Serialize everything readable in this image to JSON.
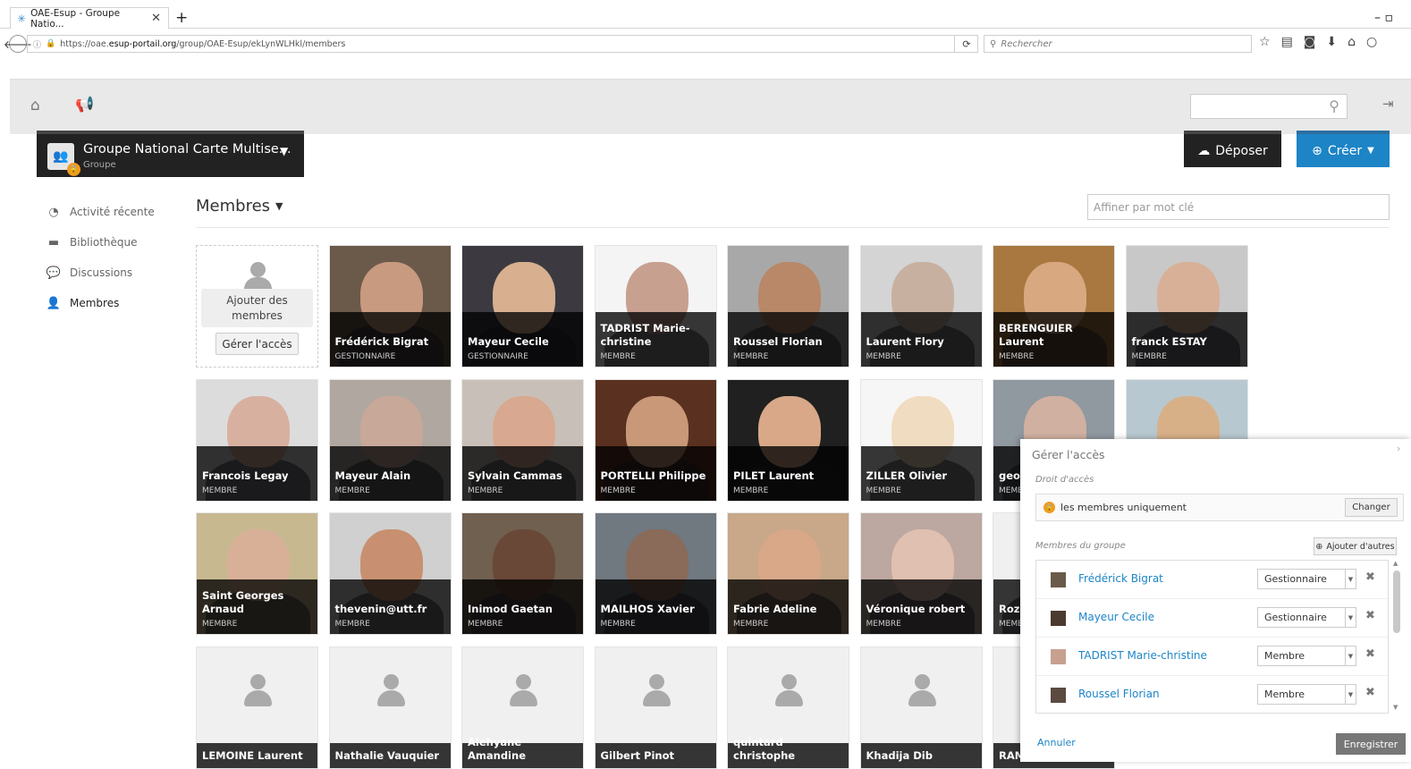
{
  "browser": {
    "tab_title": "OAE-Esup - Groupe Natio...",
    "url_prefix": "https://oae.",
    "url_host": "esup-portail.org",
    "url_path": "/group/OAE-Esup/ekLynWLHkl/members",
    "search_placeholder": "Rechercher"
  },
  "group": {
    "name": "Groupe National Carte Multise...",
    "type": "Groupe"
  },
  "actions": {
    "deposer": "Déposer",
    "creer": "Créer"
  },
  "sidebar": {
    "items": [
      {
        "label": "Activité récente",
        "icon": "dashboard-icon"
      },
      {
        "label": "Bibliothèque",
        "icon": "briefcase-icon"
      },
      {
        "label": "Discussions",
        "icon": "comments-icon"
      },
      {
        "label": "Membres",
        "icon": "user-icon"
      }
    ]
  },
  "members_view": {
    "title": "Membres",
    "filter_placeholder": "Affiner par mot clé",
    "add_members": "Ajouter des membres",
    "manage_access": "Gérer l'accès"
  },
  "members": [
    {
      "name": "Frédérick Bigrat",
      "role": "GESTIONNAIRE",
      "bg": "#6b5a4a",
      "face": "#c89a80"
    },
    {
      "name": "Mayeur Cecile",
      "role": "GESTIONNAIRE",
      "bg": "#3c3a40",
      "face": "#d8b090"
    },
    {
      "name": "TADRIST Marie-christine",
      "role": "MEMBRE",
      "bg": "#f4f4f4",
      "face": "#c8a090"
    },
    {
      "name": "Roussel Florian",
      "role": "MEMBRE",
      "bg": "#a8a8a8",
      "face": "#b88868"
    },
    {
      "name": "Laurent Flory",
      "role": "MEMBRE",
      "bg": "#d4d4d4",
      "face": "#c8b0a0"
    },
    {
      "name": "BERENGUIER Laurent",
      "role": "MEMBRE",
      "bg": "#a87840",
      "face": "#d8a880"
    },
    {
      "name": "franck ESTAY",
      "role": "MEMBRE",
      "bg": "#c8c8c8",
      "face": "#d8b098"
    },
    {
      "name": "Francois Legay",
      "role": "MEMBRE",
      "bg": "#dcdcdc",
      "face": "#d8b0a0"
    },
    {
      "name": "Mayeur Alain",
      "role": "MEMBRE",
      "bg": "#b0a8a0",
      "face": "#c8a898"
    },
    {
      "name": "Sylvain Cammas",
      "role": "MEMBRE",
      "bg": "#c8c0b8",
      "face": "#d8a890"
    },
    {
      "name": "PORTELLI Philippe",
      "role": "MEMBRE",
      "bg": "#5a3020",
      "face": "#c89878"
    },
    {
      "name": "PILET Laurent",
      "role": "MEMBRE",
      "bg": "#202020",
      "face": "#d8a888"
    },
    {
      "name": "ZILLER Olivier",
      "role": "MEMBRE",
      "bg": "#f6f6f6",
      "face": "#f0dcc0"
    },
    {
      "name": "geoffroy@...s.fr",
      "role": "MEMBRE",
      "bg": "#9098a0",
      "face": "#d0b0a0"
    },
    {
      "name": "",
      "role": "",
      "bg": "#b8c8d0",
      "face": "#d8b088"
    },
    {
      "name": "Saint Georges Arnaud",
      "role": "MEMBRE",
      "bg": "#c8b890",
      "face": "#d8b098"
    },
    {
      "name": "thevenin@utt.fr",
      "role": "MEMBRE",
      "bg": "#d0d0d0",
      "face": "#c89070"
    },
    {
      "name": "Inimod Gaetan",
      "role": "MEMBRE",
      "bg": "#706050",
      "face": "#6a4838"
    },
    {
      "name": "MAILHOS Xavier",
      "role": "MEMBRE",
      "bg": "#707880",
      "face": "#8a6a58"
    },
    {
      "name": "Fabrie Adeline",
      "role": "MEMBRE",
      "bg": "#c8a888",
      "face": "#d8a888"
    },
    {
      "name": "Véronique robert",
      "role": "MEMBRE",
      "bg": "#bca8a0",
      "face": "#e0c0b0"
    },
    {
      "name": "Roze...",
      "role": "MEMBRE",
      "bg": "#f0f0f0",
      "face": "#cccccc"
    }
  ],
  "blank_members": [
    "LEMOINE Laurent",
    "Nathalie Vauquier",
    "Alehyane Amandine",
    "Gilbert Pinot",
    "quintard christophe",
    "Khadija Dib",
    "RAM... xavie..."
  ],
  "access_panel": {
    "title": "Gérer l'accès",
    "right_label": "Droit d'accès",
    "right_value": "les membres uniquement",
    "change_button": "Changer",
    "members_label": "Membres du groupe",
    "add_others": "Ajouter d'autres",
    "rows": [
      {
        "name": "Frédérick Bigrat",
        "role": "Gestionnaire"
      },
      {
        "name": "Mayeur Cecile",
        "role": "Gestionnaire"
      },
      {
        "name": "TADRIST Marie-christine",
        "role": "Membre"
      },
      {
        "name": "Roussel Florian",
        "role": "Membre"
      }
    ],
    "cancel": "Annuler",
    "save": "Enregistrer"
  }
}
